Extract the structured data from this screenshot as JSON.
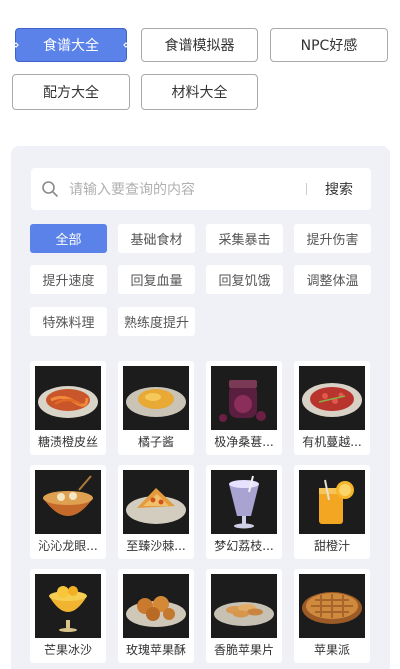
{
  "top_tabs": [
    {
      "label": "食谱大全",
      "active": true
    },
    {
      "label": "食谱模拟器",
      "active": false
    },
    {
      "label": "NPC好感",
      "active": false
    },
    {
      "label": "配方大全",
      "active": false
    },
    {
      "label": "材料大全",
      "active": false
    }
  ],
  "search": {
    "placeholder": "请输入要查询的内容",
    "button_label": "搜索"
  },
  "filters": [
    {
      "label": "全部",
      "active": true
    },
    {
      "label": "基础食材",
      "active": false
    },
    {
      "label": "采集暴击",
      "active": false
    },
    {
      "label": "提升伤害",
      "active": false
    },
    {
      "label": "提升速度",
      "active": false
    },
    {
      "label": "回复血量",
      "active": false
    },
    {
      "label": "回复饥饿",
      "active": false
    },
    {
      "label": "调整体温",
      "active": false
    },
    {
      "label": "特殊料理",
      "active": false
    },
    {
      "label": "熟练度提升",
      "active": false
    }
  ],
  "recipes": [
    {
      "name": "糖渍橙皮丝",
      "icon": "plate-orange-peel-icon"
    },
    {
      "name": "橘子酱",
      "icon": "plate-orange-jam-icon"
    },
    {
      "name": "极净桑葚...",
      "icon": "berry-jam-jar-icon"
    },
    {
      "name": "有机蔓越...",
      "icon": "plate-cranberry-icon"
    },
    {
      "name": "沁沁龙眼...",
      "icon": "bowl-longan-icon"
    },
    {
      "name": "至臻沙棘...",
      "icon": "plate-seabuckthorn-icon"
    },
    {
      "name": "梦幻荔枝...",
      "icon": "glass-lychee-drink-icon"
    },
    {
      "name": "甜橙汁",
      "icon": "glass-orange-juice-icon"
    },
    {
      "name": "芒果冰沙",
      "icon": "mango-smoothie-icon"
    },
    {
      "name": "玫瑰苹果酥",
      "icon": "plate-rose-apple-pastry-icon"
    },
    {
      "name": "香脆苹果片",
      "icon": "plate-apple-chips-icon"
    },
    {
      "name": "苹果派",
      "icon": "apple-pie-icon"
    }
  ],
  "colors": {
    "accent": "#5b82e8",
    "panel": "#f0f1f7"
  }
}
